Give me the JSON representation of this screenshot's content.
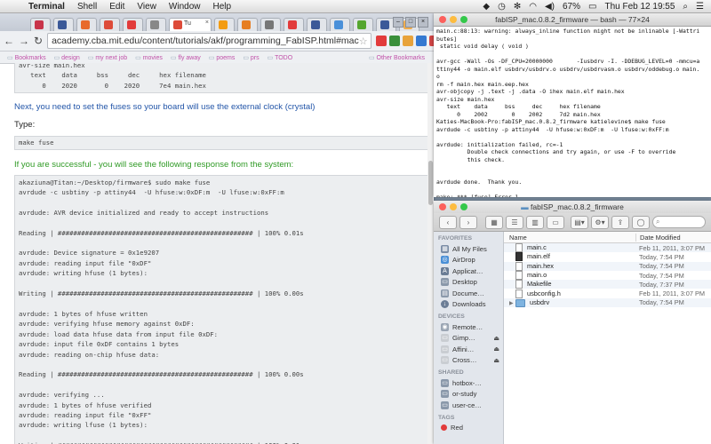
{
  "menubar": {
    "app": "Terminal",
    "items": [
      "Shell",
      "Edit",
      "View",
      "Window",
      "Help"
    ],
    "battery": "67%",
    "clock": "Thu Feb 12  19:55"
  },
  "browser": {
    "active_tab_title": "Tu",
    "url": "academy.cba.mit.edu/content/tutorials/akf/programming_FabISP.html#mac",
    "bookmarks": [
      "Bookmarks",
      "design",
      "my next job",
      "movies",
      "fly away",
      "poems",
      "prs",
      "TODO"
    ],
    "other_bookmarks": "Other Bookmarks",
    "tab_colors": [
      "#c8344a",
      "#3b5998",
      "#e86a2c",
      "#dd4b39",
      "#e23b3b",
      "#888",
      "#dd4b39",
      "#f39c12",
      "#e67e22",
      "#777",
      "#e23b3b",
      "#3b5998",
      "#4a90d9",
      "#55a630",
      "#3b5998",
      "#f0ad4e"
    ],
    "extensions": [
      "#e23b3b",
      "#3a8f3a",
      "#e8a33b",
      "#3579d1",
      "#d04545"
    ],
    "page": {
      "code_top": "avr-size main.hex\n   text    data     bss     dec     hex filename\n      0    2020       0    2020     7e4 main.hex",
      "fuses_heading": "Next, you need to set the fuses so your board will use the external clock (crystal)",
      "type_label": "Type:",
      "make_fuse_cmd": "make fuse",
      "success_text": "If you are successful - you will see the following response from the system:",
      "code_output": "akaziuna@Titan:~/Desktop/firmware$ sudo make fuse\navrdude -c usbtiny -p attiny44  -U hfuse:w:0xDF:m  -U lfuse:w:0xFF:m\n\navrdude: AVR device initialized and ready to accept instructions\n\nReading | ################################################## | 100% 0.01s\n\navrdude: Device signature = 0x1e9207\navrdude: reading input file \"0xDF\"\navrdude: writing hfuse (1 bytes):\n\nWriting | ################################################## | 100% 0.00s\n\navrdude: 1 bytes of hfuse written\navrdude: verifying hfuse memory against 0xDF:\navrdude: load data hfuse data from input file 0xDF:\navrdude: input file 0xDF contains 1 bytes\navrdude: reading on-chip hfuse data:\n\nReading | ################################################## | 100% 0.00s\n\navrdude: verifying ...\navrdude: 1 bytes of hfuse verified\navrdude: reading input file \"0xFF\"\navrdude: writing lfuse (1 bytes):\n\nWriting | ################################################## | 100% 0.01s"
    }
  },
  "terminal": {
    "title": "fabISP_mac.0.8.2_firmware — bash — 77×24",
    "output": "main.c:88:13: warning: always_inline function might not be inlinable [-Wattri\nbutes]\n static void delay ( void )\n\navr-gcc -Wall -Os -DF_CPU=20000000       -Iusbdrv -I. -DDEBUG_LEVEL=0 -mmcu=a\nttiny44 -o main.elf usbdrv/usbdrv.o usbdrv/usbdrvasm.o usbdrv/oddebug.o main.\no\nrm -f main.hex main.eep.hex\navr-objcopy -j .text -j .data -O ihex main.elf main.hex\navr-size main.hex\n   text    data     bss     dec     hex filename\n      0    2002       0    2002     7d2 main.hex\nKaties-MacBook-Pro:fabISP_mac.0.8.2_firmware katielevine$ make fuse\navrdude -c usbtiny -p attiny44  -U hfuse:w:0xDF:m  -U lfuse:w:0xFF:m\n\navrdude: initialization failed, rc=-1\n         Double check connections and try again, or use -F to override\n         this check.\n\n\navrdude done.  Thank you.\n\nmake: *** [fuse] Error 1\nKaties-MacBook-Pro:fabISP_mac.0.8.2_firmware katielevine$ "
  },
  "finder": {
    "title": "fabISP_mac.0.8.2_firmware",
    "favorites_label": "FAVORITES",
    "favorites": [
      "All My Files",
      "AirDrop",
      "Applicat…",
      "Desktop",
      "Docume…",
      "Downloads"
    ],
    "devices_label": "DEVICES",
    "devices": [
      "Remote…",
      "Gimp…",
      "Affini…",
      "Cross…"
    ],
    "shared_label": "SHARED",
    "shared": [
      "hotbox-…",
      "or-study",
      "user-ce…"
    ],
    "tags_label": "TAGS",
    "tags": [
      "Red"
    ],
    "columns": [
      "Name",
      "Date Modified"
    ],
    "files": [
      {
        "name": "main.c",
        "date": "Feb 11, 2011, 3:07 PM",
        "kind": "doc"
      },
      {
        "name": "main.elf",
        "date": "Today, 7:54 PM",
        "kind": "exe"
      },
      {
        "name": "main.hex",
        "date": "Today, 7:54 PM",
        "kind": "doc"
      },
      {
        "name": "main.o",
        "date": "Today, 7:54 PM",
        "kind": "doc"
      },
      {
        "name": "Makefile",
        "date": "Today, 7:37 PM",
        "kind": "doc"
      },
      {
        "name": "usbconfig.h",
        "date": "Feb 11, 2011, 3:07 PM",
        "kind": "doc"
      },
      {
        "name": "usbdrv",
        "date": "Today, 7:54 PM",
        "kind": "folder"
      }
    ]
  }
}
